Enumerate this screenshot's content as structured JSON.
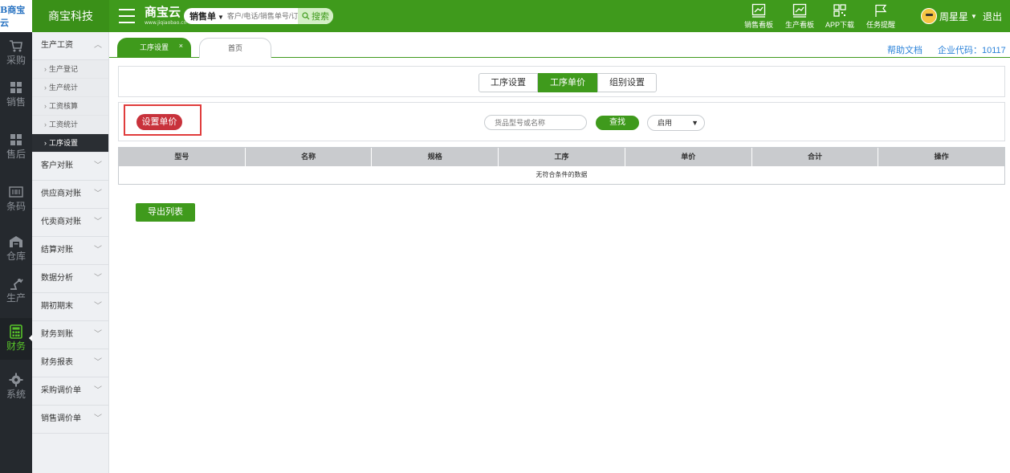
{
  "topbar": {
    "logo": "B商宝云",
    "company": "商宝科技",
    "brand_name": "商宝云",
    "brand_sub": "www.jiqiaobao.cn",
    "search_type": "销售单",
    "search_placeholder": "客户/电话/销售单号/订单号",
    "search_button": "搜索",
    "actions": [
      {
        "label": "销售看板",
        "icon": "chart-board-icon"
      },
      {
        "label": "生产看板",
        "icon": "chart-board-icon"
      },
      {
        "label": "APP下载",
        "icon": "qrcode-icon"
      },
      {
        "label": "任务提醒",
        "icon": "flag-icon"
      }
    ],
    "user_name": "周星星",
    "logout": "退出"
  },
  "rail": [
    {
      "label": "采购",
      "icon": "cart-icon"
    },
    {
      "label": "销售",
      "icon": "sales-icon"
    },
    {
      "label": "售后",
      "icon": "aftersale-icon"
    },
    {
      "label": "条码",
      "icon": "barcode-icon"
    },
    {
      "label": "仓库",
      "icon": "warehouse-icon"
    },
    {
      "label": "生产",
      "icon": "production-icon"
    },
    {
      "label": "财务",
      "icon": "calculator-icon",
      "active": true
    },
    {
      "label": "系统",
      "icon": "gear-icon"
    }
  ],
  "sidebar": {
    "open_group": "生产工资",
    "sub_items": [
      "生产登记",
      "生产统计",
      "工资核算",
      "工资统计",
      "工序设置"
    ],
    "active_sub": "工序设置",
    "groups": [
      "客户对账",
      "供应商对账",
      "代卖商对账",
      "结算对账",
      "数据分析",
      "期初期末",
      "财务到账",
      "财务报表",
      "采购调价单",
      "销售调价单"
    ]
  },
  "tabs": {
    "active": "工序设置",
    "close": "×",
    "home": "首页",
    "help": "帮助文档",
    "corp_code": "企业代码：10117"
  },
  "segment": {
    "buttons": [
      "工序设置",
      "工序单价",
      "组别设置"
    ],
    "selected": "工序单价"
  },
  "filter": {
    "set_price_button": "设置单价",
    "search_placeholder": "货品型号或名称",
    "find_button": "查找",
    "status_value": "启用"
  },
  "table": {
    "columns": [
      "型号",
      "名称",
      "规格",
      "工序",
      "单价",
      "合计",
      "操作"
    ],
    "empty_text": "无符合条件的数据"
  },
  "export_button": "导出列表",
  "colors": {
    "brand_green": "#3f9a1c",
    "rail_dark": "#25292e",
    "accent_red": "#c8323b",
    "highlight_red": "#e03c3c",
    "link_blue": "#2a82d9"
  }
}
